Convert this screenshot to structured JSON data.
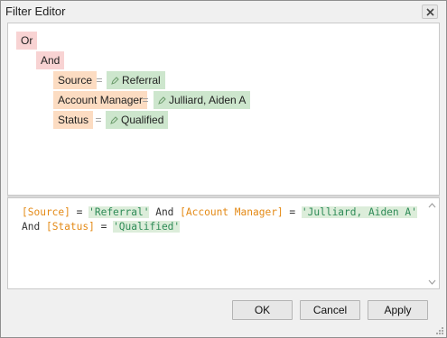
{
  "window": {
    "title": "Filter Editor"
  },
  "icons": {
    "close": "close-icon",
    "value_edit": "pencil-icon",
    "scroll_up": "chevron-up-icon",
    "scroll_down": "chevron-down-icon",
    "resize": "resize-grip-icon"
  },
  "tree": {
    "root": "Or",
    "group": "And",
    "conditions": [
      {
        "field": "Source",
        "operator": "=",
        "value": "Referral"
      },
      {
        "field": "Account Manager",
        "operator": "=",
        "value": "Julliard, Aiden A"
      },
      {
        "field": "Status",
        "operator": "=",
        "value": "Qualified"
      }
    ]
  },
  "expression": {
    "f1": "[Source]",
    "op1": " = ",
    "v1": "'Referral'",
    "and1": " And ",
    "f2": "[Account Manager]",
    "op2": " = ",
    "v2": "'Julliard, Aiden A'",
    "and2": " And ",
    "f3": "[Status]",
    "op3": " = ",
    "v3": "'Qualified'"
  },
  "buttons": {
    "ok": "OK",
    "cancel": "Cancel",
    "apply": "Apply"
  },
  "colors": {
    "group_bg": "#f8d3d3",
    "field_bg": "#fcdcc2",
    "value_bg": "#cde6cd",
    "expr_field": "#e48a16",
    "expr_value": "#2e8b57"
  }
}
